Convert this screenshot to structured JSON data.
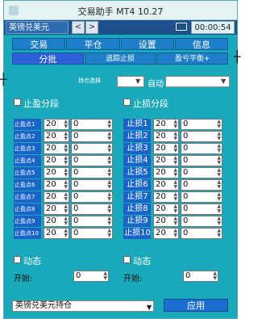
{
  "window": {
    "title": "交易助手 MT4 10.27"
  },
  "toolbar": {
    "symbol": "英镑兑美元",
    "prev": "<",
    "next": ">",
    "clock": "00:00:54"
  },
  "tabs_main": [
    "交易",
    "平仓",
    "设置",
    "信息"
  ],
  "tabs_sub": [
    "分批",
    "追踪止损",
    "盈亏平衡+"
  ],
  "filters": {
    "left_label": "持仓选择",
    "right_label": "自动"
  },
  "take_profit": {
    "enable_label": "止盈分段",
    "labels": [
      "止盈点1",
      "止盈点2",
      "止盈点3",
      "止盈点4",
      "止盈点5",
      "止盈点6",
      "止盈点7",
      "止盈点8",
      "止盈点9",
      "止盈点10"
    ],
    "pct": [
      "20",
      "20",
      "20",
      "20",
      "20",
      "20",
      "20",
      "20",
      "20",
      "20"
    ],
    "pts": [
      "0",
      "0",
      "0",
      "0",
      "0",
      "0",
      "0",
      "0",
      "0",
      "0"
    ]
  },
  "stop_loss": {
    "enable_label": "止损分段",
    "labels": [
      "止损1",
      "止损2",
      "止损3",
      "止损4",
      "止损5",
      "止损6",
      "止损7",
      "止损8",
      "止损9",
      "止损10"
    ],
    "pct": [
      "20",
      "20",
      "20",
      "20",
      "20",
      "20",
      "20",
      "20",
      "20",
      "20"
    ],
    "pts": [
      "0",
      "0",
      "0",
      "0",
      "0",
      "0",
      "0",
      "0",
      "0",
      "0"
    ]
  },
  "dynamic": {
    "left": {
      "label": "动态",
      "start_label": "开始:",
      "start_value": "0"
    },
    "right": {
      "label": "动态",
      "start_label": "开始:",
      "start_value": "0"
    }
  },
  "footer": {
    "symbol": "英镑兑美元持仓",
    "apply": "应用"
  }
}
